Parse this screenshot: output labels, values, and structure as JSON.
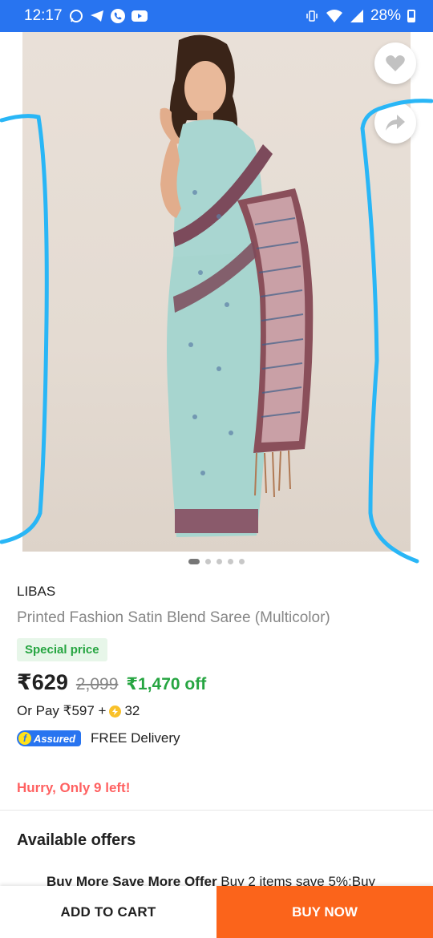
{
  "status_bar": {
    "time": "12:17",
    "notification_icons": [
      "whatsapp-icon",
      "telegram-icon",
      "phone-icon",
      "youtube-icon"
    ],
    "battery": "28%"
  },
  "gallery": {
    "image_description_icon": "saree-photo",
    "page_count": 5,
    "active_page": 1,
    "wishlist_icon": "heart-icon",
    "share_icon": "share-icon"
  },
  "product": {
    "brand": "LIBAS",
    "title": "Printed Fashion Satin Blend Saree (Multicolor)",
    "badge": "Special price",
    "price": "₹629",
    "mrp": "2,099",
    "discount": "₹1,470 off",
    "or_pay": "Or Pay ₹597 +",
    "coins": "32",
    "assured": "Assured",
    "delivery": "FREE Delivery",
    "stock_warning": "Hurry, Only 9 left!"
  },
  "offers": {
    "heading": "Available offers",
    "items": [
      {
        "title": "Buy More Save More Offer",
        "text": "Buy 2 items save 5%;Buy"
      }
    ]
  },
  "actions": {
    "add_to_cart": "ADD TO CART",
    "buy_now": "BUY NOW"
  },
  "colors": {
    "brand_blue": "#2874f0",
    "buy_orange": "#fb641b",
    "discount_green": "#26a541",
    "warning_red": "#ff6161",
    "annotation_cyan": "#29b6f6"
  }
}
